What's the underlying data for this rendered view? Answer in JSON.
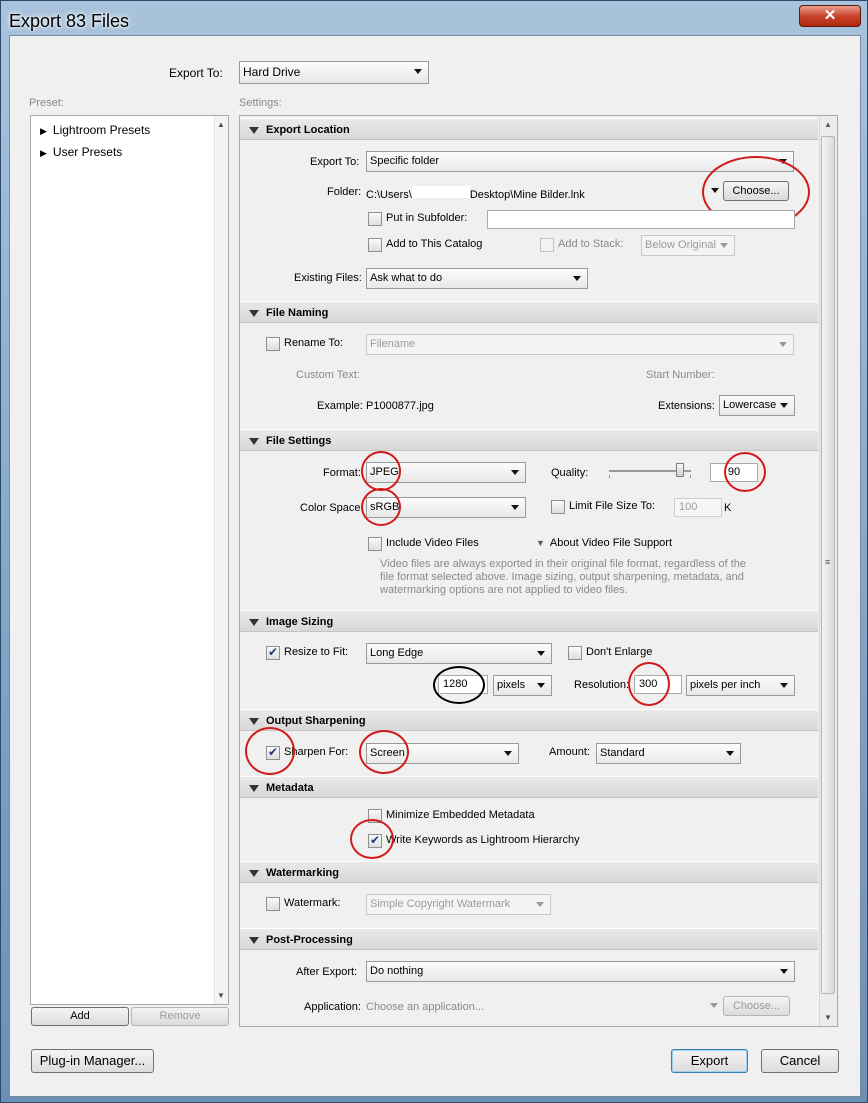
{
  "window": {
    "title": "Export 83 Files"
  },
  "export_to": {
    "label": "Export To:",
    "value": "Hard Drive"
  },
  "preset": {
    "label": "Preset:",
    "items": [
      "Lightroom Presets",
      "User Presets"
    ],
    "add": "Add",
    "remove": "Remove"
  },
  "settings_label": "Settings:",
  "export_location": {
    "header": "Export Location",
    "export_to_label": "Export To:",
    "export_to_value": "Specific folder",
    "folder_label": "Folder:",
    "folder_path_a": "C:\\Users\\",
    "folder_path_b": "Desktop\\Mine Bilder.lnk",
    "choose": "Choose...",
    "subfolder_label": "Put in Subfolder:",
    "add_catalog": "Add to This Catalog",
    "add_stack": "Add to Stack:",
    "stack_value": "Below Original",
    "existing_label": "Existing Files:",
    "existing_value": "Ask what to do"
  },
  "file_naming": {
    "header": "File Naming",
    "rename_label": "Rename To:",
    "rename_value": "Filename",
    "custom_text": "Custom Text:",
    "start_number": "Start Number:",
    "example_label": "Example:",
    "example_value": "P1000877.jpg",
    "extensions_label": "Extensions:",
    "extensions_value": "Lowercase"
  },
  "file_settings": {
    "header": "File Settings",
    "format_label": "Format:",
    "format_value": "JPEG",
    "quality_label": "Quality:",
    "quality_value": "90",
    "quality_fraction": 0.9,
    "colorspace_label": "Color Space:",
    "colorspace_value": "sRGB",
    "limit_label": "Limit File Size To:",
    "limit_value": "100",
    "limit_unit": "K",
    "video_label": "Include Video Files",
    "about_video": "About Video File Support",
    "video_note_1": "Video files are always exported in their original file format, regardless of the",
    "video_note_2": "file format selected above. Image sizing, output sharpening, metadata, and",
    "video_note_3": "watermarking options are not applied to video files."
  },
  "image_sizing": {
    "header": "Image Sizing",
    "resize_label": "Resize to Fit:",
    "resize_value": "Long Edge",
    "dont_enlarge": "Don't Enlarge",
    "size_value": "1280",
    "size_unit": "pixels",
    "resolution_label": "Resolution:",
    "resolution_value": "300",
    "resolution_unit": "pixels per inch"
  },
  "output_sharpening": {
    "header": "Output Sharpening",
    "sharpen_label": "Sharpen For:",
    "sharpen_value": "Screen",
    "amount_label": "Amount:",
    "amount_value": "Standard"
  },
  "metadata": {
    "header": "Metadata",
    "minimize": "Minimize Embedded Metadata",
    "keywords": "Write Keywords as Lightroom Hierarchy"
  },
  "watermarking": {
    "header": "Watermarking",
    "watermark_label": "Watermark:",
    "watermark_value": "Simple Copyright Watermark"
  },
  "post_processing": {
    "header": "Post-Processing",
    "after_label": "After Export:",
    "after_value": "Do nothing",
    "app_label": "Application:",
    "app_placeholder": "Choose an application...",
    "choose": "Choose..."
  },
  "footer": {
    "plugin": "Plug-in Manager...",
    "export": "Export",
    "cancel": "Cancel"
  }
}
